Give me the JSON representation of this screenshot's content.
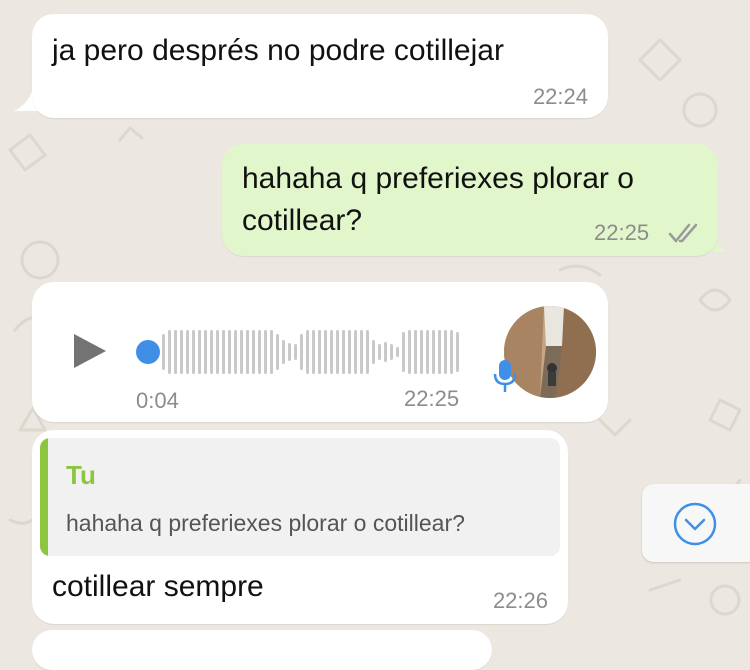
{
  "messages": [
    {
      "id": "m1",
      "direction": "incoming",
      "text": "ja pero després no podre cotillejar",
      "time": "22:24"
    },
    {
      "id": "m2",
      "direction": "outgoing",
      "text_line1": "hahaha q preferiexes plorar o",
      "text_line2": "cotillear?",
      "time": "22:25",
      "status": "read"
    },
    {
      "id": "m3",
      "direction": "incoming",
      "type": "voice",
      "duration": "0:04",
      "time": "22:25"
    },
    {
      "id": "m4",
      "direction": "incoming",
      "quote_author": "Tu",
      "quote_text": "hahaha q preferiexes plorar o cotillear?",
      "text": "cotillear sempre",
      "time": "22:26"
    }
  ],
  "icons": {
    "play": "play-icon",
    "mic": "microphone-icon",
    "read": "double-check-icon",
    "scroll": "chevron-down-icon"
  },
  "colors": {
    "outgoing_bubble": "#e1f7cb",
    "incoming_bubble": "#ffffff",
    "quote_bar": "#8cc63f",
    "quote_author": "#8cc63f",
    "accent_blue": "#3f8fe6",
    "wallpaper": "#ece8e1"
  }
}
